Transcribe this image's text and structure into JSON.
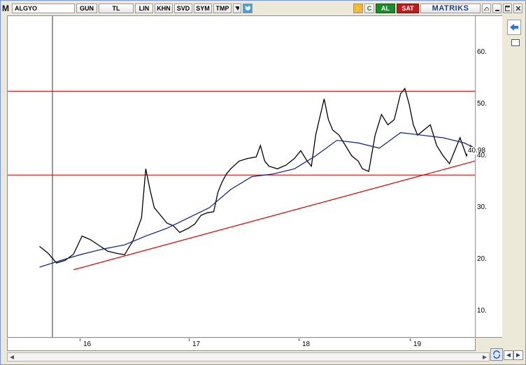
{
  "toolbar": {
    "logo": "M",
    "symbol": "ALGYO",
    "period": "GUN",
    "currency": "TL",
    "scale": "LIN",
    "buttons": [
      "KHN",
      "SVD",
      "SYM",
      "TMP"
    ],
    "bolt": "⚡",
    "c_label": "C",
    "buy_label": "AL",
    "sell_label": "SAT",
    "brand": "MATRIKS"
  },
  "chart_data": {
    "type": "line",
    "title": "",
    "x_labels": [
      "16",
      "17",
      "18",
      "19"
    ],
    "y_ticks": [
      10,
      20,
      30,
      40,
      50,
      60
    ],
    "ylim": [
      5,
      67
    ],
    "last_value": "40.98",
    "series": [
      {
        "color": "#000000",
        "points": [
          [
            0,
            22.5
          ],
          [
            4,
            21.2
          ],
          [
            8,
            19.3
          ],
          [
            12,
            19.8
          ],
          [
            16,
            21.0
          ],
          [
            20,
            24.5
          ],
          [
            24,
            23.8
          ],
          [
            28,
            22.7
          ],
          [
            32,
            21.6
          ],
          [
            36,
            21.2
          ],
          [
            40,
            20.9
          ],
          [
            44,
            23.6
          ],
          [
            48,
            28.0
          ],
          [
            50,
            37.5
          ],
          [
            52,
            33.5
          ],
          [
            54,
            30.0
          ],
          [
            57,
            28.5
          ],
          [
            60,
            27.0
          ],
          [
            63,
            26.5
          ],
          [
            66,
            25.2
          ],
          [
            70,
            26.0
          ],
          [
            73,
            26.8
          ],
          [
            76,
            28.5
          ],
          [
            79,
            29.0
          ],
          [
            82,
            29.2
          ],
          [
            84,
            33.0
          ],
          [
            86,
            35.0
          ],
          [
            88,
            36.5
          ],
          [
            90,
            37.5
          ],
          [
            94,
            39.0
          ],
          [
            98,
            39.5
          ],
          [
            102,
            39.8
          ],
          [
            104,
            42.0
          ],
          [
            106,
            39.0
          ],
          [
            108,
            38.0
          ],
          [
            112,
            37.5
          ],
          [
            116,
            38.2
          ],
          [
            120,
            39.5
          ],
          [
            123,
            41.0
          ],
          [
            126,
            39.0
          ],
          [
            128,
            38.0
          ],
          [
            130,
            44.0
          ],
          [
            132,
            47.5
          ],
          [
            134,
            51.0
          ],
          [
            136,
            47.0
          ],
          [
            138,
            45.0
          ],
          [
            141,
            44.0
          ],
          [
            144,
            42.0
          ],
          [
            147,
            40.0
          ],
          [
            150,
            39.0
          ],
          [
            152,
            37.5
          ],
          [
            155,
            37.0
          ],
          [
            158,
            44.0
          ],
          [
            161,
            48.0
          ],
          [
            164,
            46.0
          ],
          [
            167,
            47.0
          ],
          [
            170,
            52.0
          ],
          [
            172,
            53.0
          ],
          [
            174,
            50.0
          ],
          [
            176,
            46.0
          ],
          [
            178,
            44.0
          ],
          [
            181,
            45.0
          ],
          [
            184,
            46.0
          ],
          [
            187,
            42.0
          ],
          [
            190,
            40.0
          ],
          [
            193,
            38.5
          ],
          [
            195,
            40.5
          ],
          [
            198,
            43.5
          ],
          [
            201,
            40.0
          ],
          [
            203,
            42.0
          ],
          [
            205,
            41.0
          ]
        ]
      },
      {
        "color": "#0a1a8a",
        "points": [
          [
            0,
            18.5
          ],
          [
            10,
            19.8
          ],
          [
            20,
            21.0
          ],
          [
            30,
            22.0
          ],
          [
            40,
            22.8
          ],
          [
            50,
            24.5
          ],
          [
            60,
            26.0
          ],
          [
            70,
            28.0
          ],
          [
            80,
            30.0
          ],
          [
            90,
            33.5
          ],
          [
            100,
            36.0
          ],
          [
            110,
            36.5
          ],
          [
            120,
            37.5
          ],
          [
            130,
            40.0
          ],
          [
            140,
            43.0
          ],
          [
            150,
            42.5
          ],
          [
            160,
            41.5
          ],
          [
            170,
            44.5
          ],
          [
            180,
            44.0
          ],
          [
            190,
            43.5
          ],
          [
            200,
            42.5
          ],
          [
            205,
            41.5
          ]
        ]
      }
    ],
    "hlines": [
      {
        "color": "#cc0000",
        "value": 52.5
      },
      {
        "color": "#cc0000",
        "value": 36.3
      }
    ],
    "trendline": {
      "color": "#cc0000",
      "from": [
        16,
        18.0
      ],
      "to": [
        205,
        39.0
      ]
    },
    "xrange": [
      -15,
      205
    ]
  }
}
